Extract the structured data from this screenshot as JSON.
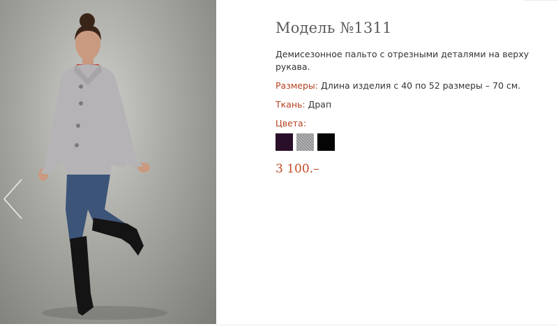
{
  "product": {
    "title": "Модель №1311",
    "description": "Демисезонное пальто  с отрезными деталями на верху рукава.",
    "sizes_label": "Размеры:",
    "sizes_value": " Длина изделия с 40 по 52 размеры – 70 см.",
    "fabric_label": "Ткань:",
    "fabric_value": " Драп",
    "colors_label": "Цвета:",
    "colors": [
      {
        "name": "dark-purple",
        "hex": "#2a0f2a"
      },
      {
        "name": "grey-melange",
        "hex": "#9a9a9c"
      },
      {
        "name": "black",
        "hex": "#050505"
      }
    ],
    "price": "3 100.–"
  },
  "icons": {
    "prev": "chevron-left-icon"
  }
}
